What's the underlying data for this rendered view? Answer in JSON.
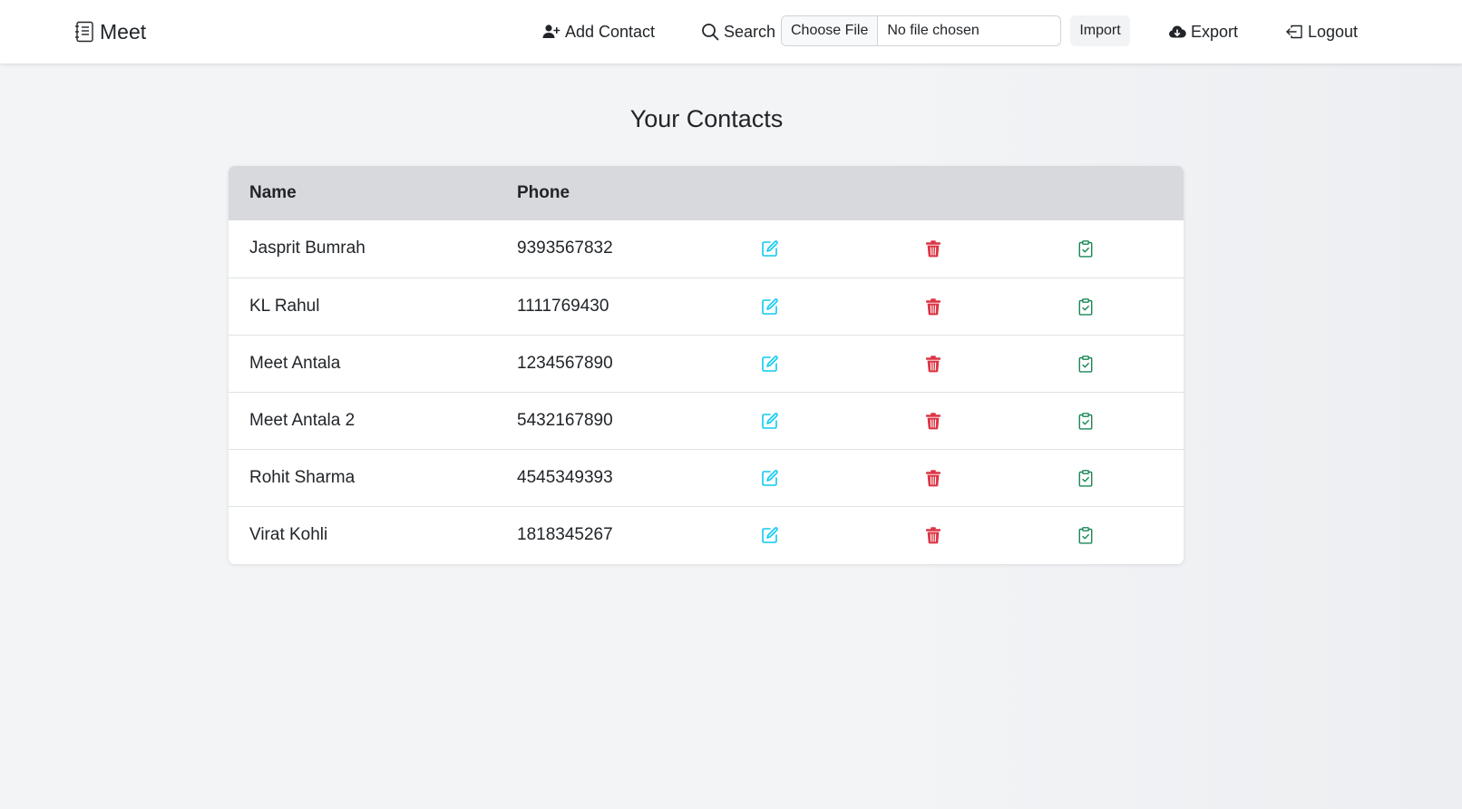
{
  "navbar": {
    "brand": "Meet",
    "add_contact": "Add Contact",
    "search": "Search",
    "file_input": {
      "button": "Choose File",
      "status": "No file chosen"
    },
    "import": "Import",
    "export": "Export",
    "logout": "Logout"
  },
  "main": {
    "title": "Your Contacts",
    "table": {
      "columns": [
        "Name",
        "Phone"
      ],
      "rows": [
        {
          "name": "Jasprit Bumrah",
          "phone": "9393567832"
        },
        {
          "name": "KL Rahul",
          "phone": "1111769430"
        },
        {
          "name": "Meet Antala",
          "phone": "1234567890"
        },
        {
          "name": "Meet Antala 2",
          "phone": "5432167890"
        },
        {
          "name": "Rohit Sharma",
          "phone": "4545349393"
        },
        {
          "name": "Virat Kohli",
          "phone": "1818345267"
        }
      ]
    }
  },
  "colors": {
    "edit": "#0dcaf0",
    "delete": "#dc3545",
    "clipboard": "#198754",
    "table_header_bg": "#d8d9dd"
  },
  "icons": {
    "brand": "notebook-icon",
    "add_contact": "person-plus-icon",
    "search": "search-icon",
    "export": "cloud-download-icon",
    "logout": "box-arrow-left-icon",
    "edit": "pencil-square-icon",
    "delete": "trash-icon",
    "clipboard": "clipboard-check-icon"
  }
}
